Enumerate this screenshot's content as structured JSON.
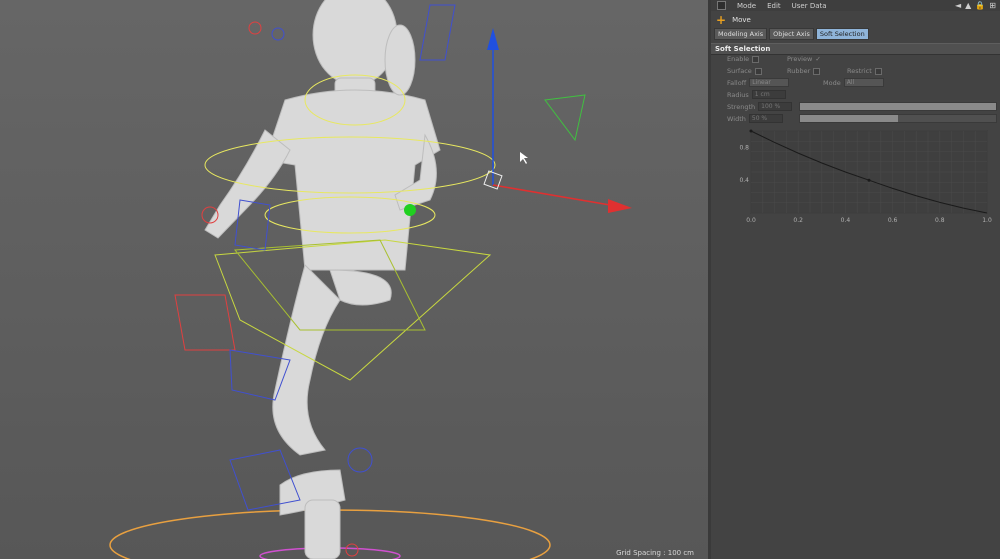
{
  "viewport": {
    "grid_spacing": "Grid Spacing : 100 cm"
  },
  "panel": {
    "menu": [
      "Mode",
      "Edit",
      "User Data"
    ],
    "nav": {
      "back": "◄",
      "up": "▲",
      "lock": "🔒",
      "more": "⊞"
    },
    "tool": "Move",
    "tabs": [
      "Modeling Axis",
      "Object Axis",
      "Soft Selection"
    ],
    "active_tab": "Soft Selection",
    "section_title": "Soft Selection",
    "fields": {
      "enable_label": "Enable",
      "preview_label": "Preview",
      "preview_check": "✓",
      "surface_label": "Surface",
      "rubber_label": "Rubber",
      "restrict_label": "Restrict",
      "falloff_label": "Falloff",
      "falloff_value": "Linear",
      "mode_label": "Mode",
      "mode_value": "All",
      "radius_label": "Radius",
      "radius_value": "1 cm",
      "strength_label": "Strength",
      "strength_value": "100 %",
      "strength_fraction": 1.0,
      "width_label": "Width",
      "width_value": "50 %",
      "width_fraction": 0.5
    }
  },
  "chart_data": {
    "type": "line",
    "x": [
      0.0,
      0.1,
      0.2,
      0.3,
      0.4,
      0.5,
      0.6,
      0.7,
      0.8,
      0.9,
      1.0
    ],
    "y": [
      1.0,
      0.86,
      0.73,
      0.61,
      0.5,
      0.4,
      0.3,
      0.21,
      0.13,
      0.06,
      0.0
    ],
    "xlim": [
      0,
      1
    ],
    "ylim": [
      0,
      1
    ],
    "x_ticks": [
      "0.0",
      "0.2",
      "0.4",
      "0.6",
      "0.8",
      "1.0"
    ],
    "y_ticks": [
      "0.4",
      "0.8"
    ],
    "grid": true
  }
}
